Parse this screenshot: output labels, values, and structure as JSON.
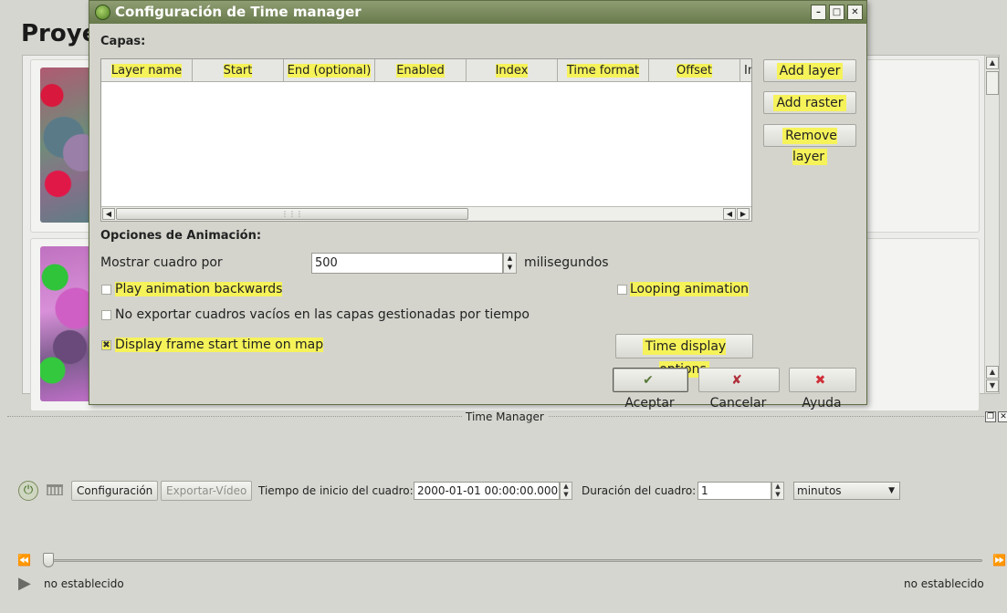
{
  "background": {
    "title": "Proye",
    "dock": {
      "title": "Time Manager",
      "config_button": "Configuración",
      "export_button": "Exportar-Vídeo",
      "start_time_label": "Tiempo de inicio del cuadro:",
      "start_time_value": "2000-01-01 00:00:00.000",
      "duration_label": "Duración del cuadro:",
      "duration_value": "1",
      "unit_value": "minutos",
      "left_status": "no establecido",
      "right_status": "no establecido"
    }
  },
  "dialog": {
    "title": "Configuración de Time manager",
    "layers_label": "Capas:",
    "columns": [
      "Layer name",
      "Start",
      "End (optional)",
      "Enabled",
      "Index",
      "Time format",
      "Offset",
      "In"
    ],
    "layer_buttons": {
      "add_layer": "Add layer",
      "add_raster": "Add raster",
      "remove_layer": "Remove layer"
    },
    "animation": {
      "section_label": "Opciones de Animación:",
      "show_frame_label": "Mostrar cuadro por",
      "interval_value": "500",
      "unit_label": "milisegundos",
      "play_backwards_label": "Play animation backwards",
      "play_backwards_checked": false,
      "looping_label": "Looping animation",
      "looping_checked": false,
      "no_export_label": "No exportar cuadros vacíos en las capas gestionadas por tiempo",
      "no_export_checked": false,
      "display_start_label": "Display frame start time on map",
      "display_start_checked": true,
      "time_display_button": "Time display options"
    },
    "footer": {
      "ok": "Aceptar",
      "cancel": "Cancelar",
      "help": "Ayuda"
    }
  },
  "colors": {
    "highlight": "#f5f25a",
    "titlebar": "#7a8a5c"
  }
}
